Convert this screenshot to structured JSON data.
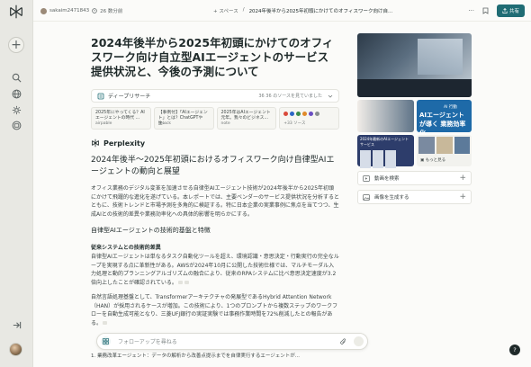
{
  "topbar": {
    "username": "sakaim2471843",
    "time": "26 数分前",
    "space_label": "+ スペース",
    "separator": "/",
    "thread_title": "2024年後半から2025年初頭にかけてのオフィスワーク向け自...",
    "more": "···",
    "share_label": "共有"
  },
  "page": {
    "title": "2024年後半から2025年初頭にかけてのオフィスワーク向け自立型AIエージェントのサービス提供状況と、今後の予測について"
  },
  "research": {
    "label": "ディープリサーチ",
    "count": "36 36 のソースを見ていました"
  },
  "sources": [
    {
      "title": "2025年にやってくる？AIエージェントの時代 ...",
      "site": "airpable"
    },
    {
      "title": "【事例付】「AIエージェント」とは？ChatGPTや生...",
      "site": "seleck"
    },
    {
      "title": "2025年はAIエージェント元年。我々のビジネス...",
      "site": "note"
    }
  ],
  "sources_more": "+33 ソース",
  "answer": {
    "brand": "Perplexity",
    "h2": "2024年後半〜2025年初頭におけるオフィスワーク向け自律型AIエージェントの動向と展望",
    "intro": "オフィス業務のデジタル変革を加速させる自律型AIエージェント技術が2024年後半から2025年初頭にかけて飛躍的な進化を遂げている。本レポートでは、主要ベンダーのサービス提供状況を分析するとともに、技術トレンドと市場予測を多角的に検証する。特に日本企業の実業事例に焦点を当てつつ、生成AIとの技術的差異や業務効率化への具体的影響を明らかにする。",
    "h3": "自律型AIエージェントの技術的基盤と特徴",
    "h4": "従来システムとの技術的差異",
    "p1": "自律型AIエージェントは単なるタスク自動化ツールを超え、環境認識・意思決定・行動実行の完全なループを実現する点に革新性がある。AWSが2024年10月に公開した技術仕様では、マルチモーダル入力処理と動的プランニングアルゴリズムの融合により、従来のRPAシステムに比べ意思決定速度が3.2倍向上したことが確認されている。",
    "p2": "自然言語処理基盤として、Transformerアーキテクチャの発展型であるHybrid Attention Network（HAN）が採用されるケースが増加。この技術により、1つのプロンプトから複数ステップのワークフローを自動生成可能となり、三菱UFJ銀行の実証実験では事務作業時間を72%削減したとの報告がある。",
    "bottom": "1. 業務改革エージェント：データの解析から改善点提示までを自律実行するエージェントが..."
  },
  "followup": {
    "placeholder": "フォローアップを尋ねる"
  },
  "side": {
    "img_b_small": "AI 行動",
    "img_b_text": "AIエージェントが導く 業務効率化",
    "img_c_text": "2024年最新のAIエージェントサービス",
    "img_d_label": "もっと見る",
    "video_label": "動画を検索",
    "image_label": "画像を生成する"
  },
  "help": "?"
}
